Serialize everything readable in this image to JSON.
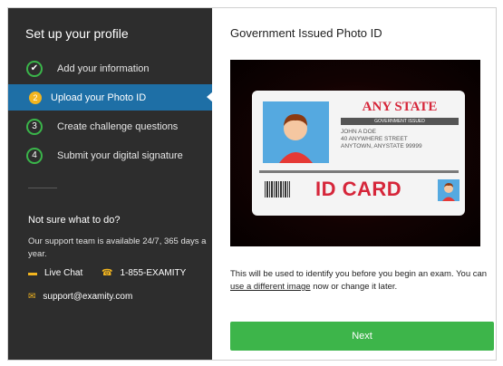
{
  "sidebar": {
    "title": "Set up your profile",
    "steps": [
      {
        "number": "✔",
        "label": "Add your information"
      },
      {
        "number": "2",
        "label": "Upload your Photo ID"
      },
      {
        "number": "3",
        "label": "Create challenge questions"
      },
      {
        "number": "4",
        "label": "Submit your digital signature"
      }
    ],
    "help": {
      "title": "Not sure what to do?",
      "text": "Our support team is available 24/7, 365 days a year.",
      "live_chat": "Live Chat",
      "phone": "1-855-EXAMITY",
      "email": "support@examity.com"
    }
  },
  "main": {
    "title": "Government Issued Photo ID",
    "card": {
      "state": "ANY STATE",
      "issued": "GOVERNMENT ISSUED",
      "name": "JOHN A DOE",
      "street": "40 ANYWHERE STREET",
      "city": "ANYTOWN, ANYSTATE 99999",
      "id_text": "ID CARD"
    },
    "caption_before": "This will be used to identify you before you begin an exam. You can",
    "caption_link": "use a different image",
    "caption_after": " now or change it later.",
    "next_label": "Next"
  },
  "colors": {
    "sidebar_bg": "#2d2d2d",
    "active_step": "#1e6fa6",
    "accent_green": "#3db54a",
    "accent_yellow": "#f2b51f",
    "card_red": "#d6263a"
  }
}
